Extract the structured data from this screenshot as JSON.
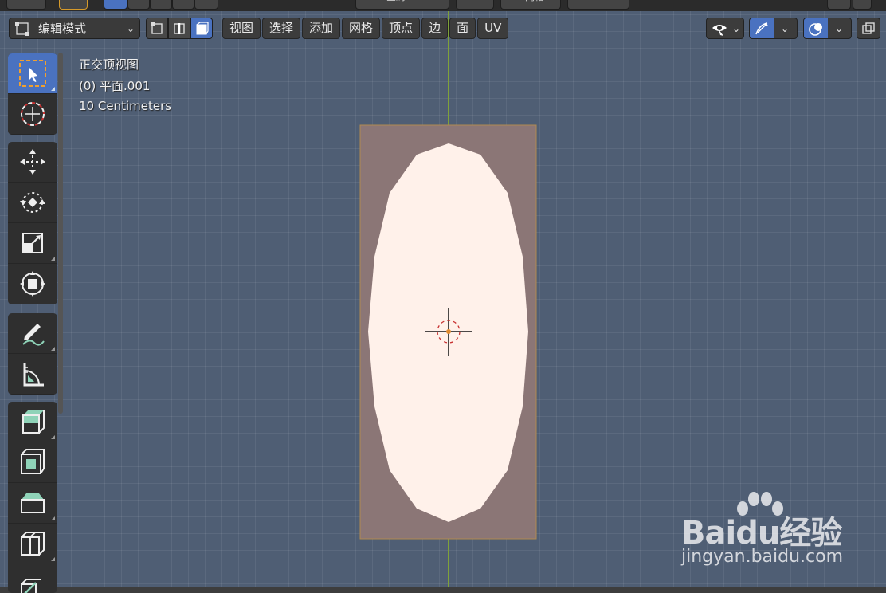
{
  "header_cutoff": {
    "transform_orientation": "全局",
    "snap_label": "网格"
  },
  "toolbar": {
    "mode": "编辑模式",
    "menus": [
      "视图",
      "选择",
      "添加",
      "网格",
      "顶点",
      "边",
      "面",
      "UV"
    ]
  },
  "viewport": {
    "view_name": "正交顶视图",
    "object_name": "(0) 平面.001",
    "scale_text": "10 Centimeters"
  },
  "colors": {
    "background": "#4f5e74",
    "plane": "#8b7676",
    "face": "#fff1ea",
    "accent": "#4a72c0"
  },
  "tools": [
    {
      "name": "select-box-tool",
      "active": true
    },
    {
      "name": "cursor-tool"
    },
    {
      "name": "move-tool"
    },
    {
      "name": "rotate-tool"
    },
    {
      "name": "scale-tool"
    },
    {
      "name": "transform-tool"
    },
    {
      "name": "annotate-tool"
    },
    {
      "name": "measure-tool"
    },
    {
      "name": "extrude-region-tool"
    },
    {
      "name": "inset-faces-tool"
    },
    {
      "name": "bevel-tool"
    },
    {
      "name": "loop-cut-tool"
    },
    {
      "name": "knife-tool"
    }
  ],
  "watermark": {
    "brand": "Baidu经验",
    "url": "jingyan.baidu.com"
  }
}
